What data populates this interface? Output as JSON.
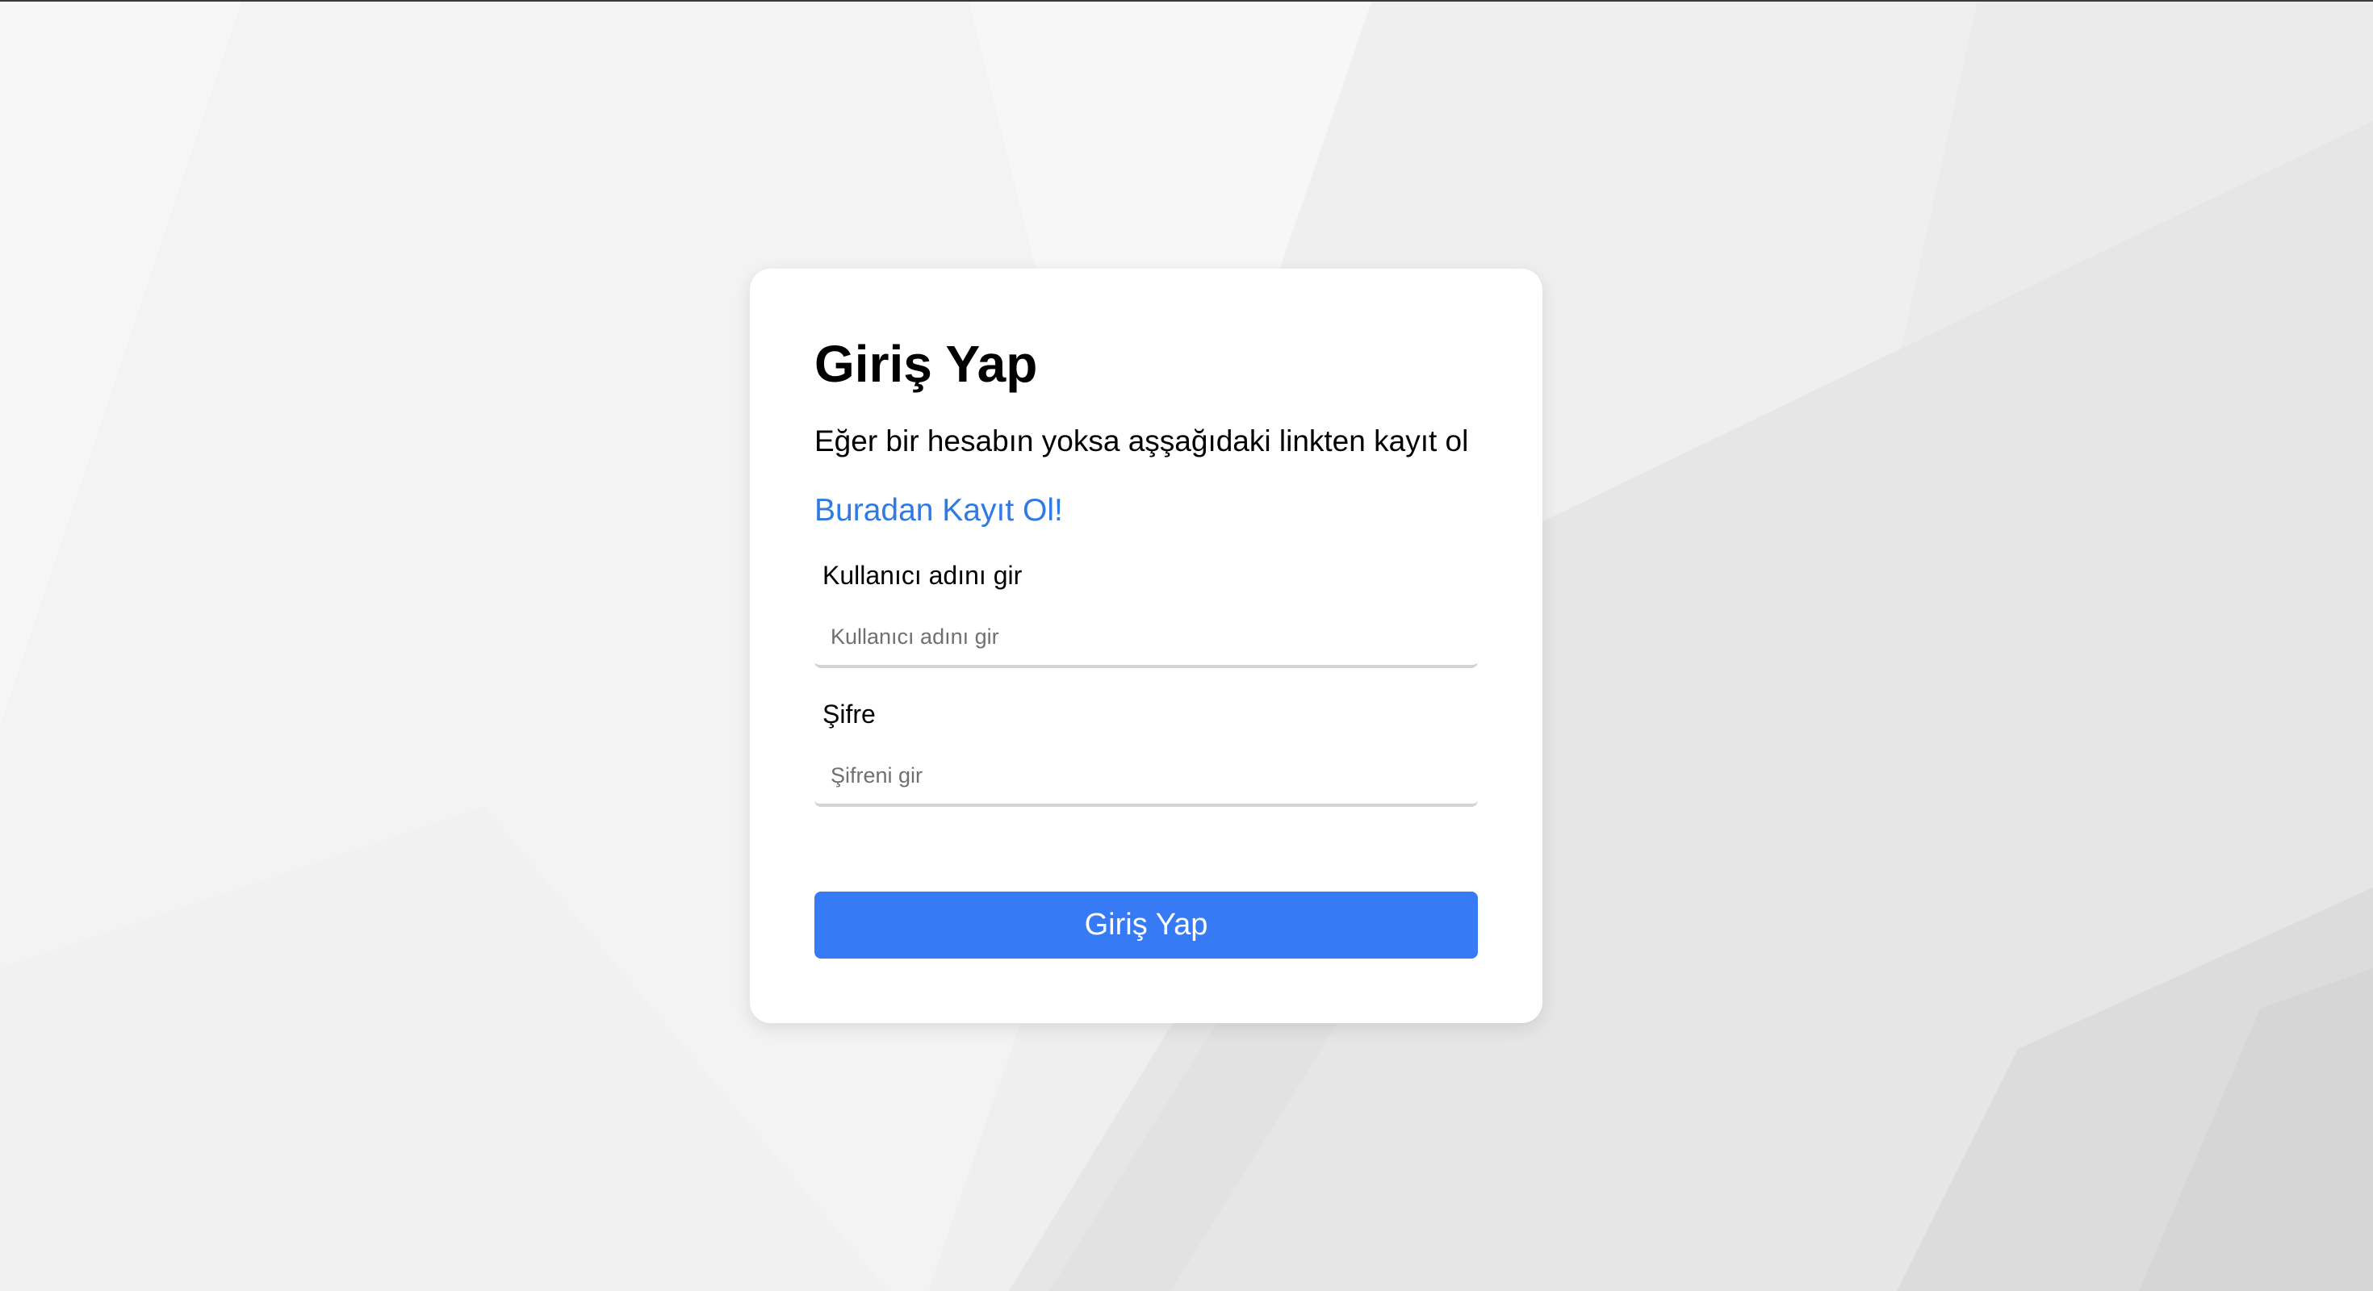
{
  "theme": {
    "accent": "#367bf5",
    "link_color": "#2f7ae5",
    "background": "#f7f7f7",
    "card_background": "#ffffff"
  },
  "login": {
    "title": "Giriş Yap",
    "subtitle": "Eğer bir hesabın yoksa aşşağıdaki linkten kayıt ol",
    "register_link": "Buradan Kayıt Ol!",
    "username": {
      "label": "Kullanıcı adını gir",
      "placeholder": "Kullanıcı adını gir",
      "value": ""
    },
    "password": {
      "label": "Şifre",
      "placeholder": "Şifreni gir",
      "value": ""
    },
    "submit_label": "Giriş Yap"
  }
}
